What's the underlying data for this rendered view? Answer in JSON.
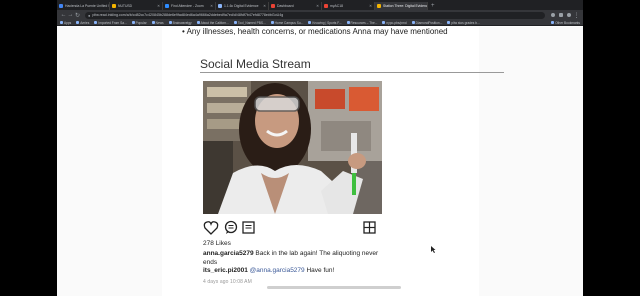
{
  "browser": {
    "tabs": [
      {
        "label": "Hacienda La Puente Unified S",
        "color": "#4285f4",
        "active": false
      },
      {
        "label": "NUTUSD",
        "color": "#f4b400",
        "active": false
      },
      {
        "label": "Find Attendee - Zoom",
        "color": "#2d8cff",
        "active": false
      },
      {
        "label": "1.1.6c Digital Evidence",
        "color": "#8ab4f8",
        "active": false
      },
      {
        "label": "Dashboard",
        "color": "#ea4335",
        "active": false
      },
      {
        "label": "myAC18",
        "color": "#ea4335",
        "active": false
      },
      {
        "label": "Station Three: Digital Evidence",
        "color": "#f4b400",
        "active": true
      }
    ],
    "new_tab_glyph": "+",
    "window_close_glyph": "✕",
    "url": "pltw.read.inkling.com/a/b/cd82cc7c420845b288de6e9fad84ed6a4a9666a2ddebed9a7ed/d/48fdf7b47efd8778e#bGoU4g",
    "bookmarks": [
      "Apps",
      "Aeries",
      "Imported From Sa...",
      "Popular",
      "News",
      "Brainwavelgy",
      "About the Californ...",
      "Tool_Named PBS...",
      "Home Campus Su...",
      "Knowing | Sports F...",
      "Resources – The...",
      "nypo-pbs/pmd",
      "DiamondPosition...",
      "pltw stos grades b..."
    ],
    "other_bookmarks": "Other Bookmarks"
  },
  "article": {
    "bullet_text": "Any illnesses, health concerns, or medications Anna may have mentioned",
    "section_title": "Social Media Stream"
  },
  "post": {
    "likes": "278 Likes",
    "caption_user": "anna.garcia5279",
    "caption_text": " Back in the lab again! The aliquoting never ends",
    "comment_user": "its_eric.pi2001",
    "comment_mention": "@anna.garcia5279",
    "comment_text": " Have fun!",
    "timestamp": "4 days ago 10:08 AM"
  }
}
